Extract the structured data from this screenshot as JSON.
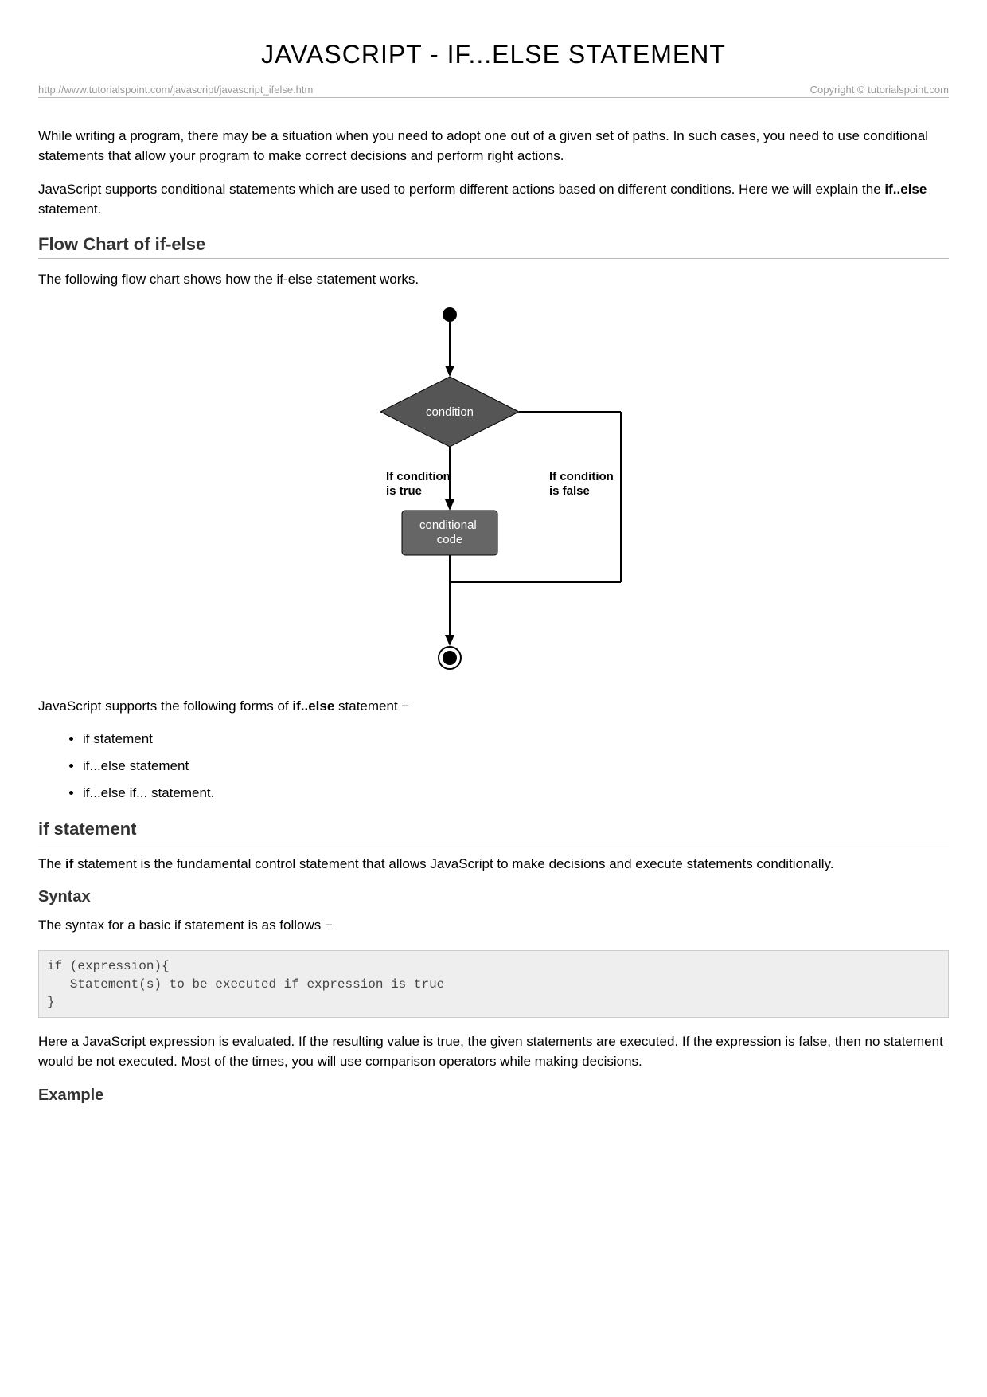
{
  "title": "JAVASCRIPT - IF...ELSE STATEMENT",
  "meta": {
    "url": "http://www.tutorialspoint.com/javascript/javascript_ifelse.htm",
    "copyright": "Copyright © tutorialspoint.com"
  },
  "paragraphs": {
    "intro1": "While writing a program, there may be a situation when you need to adopt one out of a given set of paths. In such cases, you need to use conditional statements that allow your program to make correct decisions and perform right actions.",
    "intro2_pre": "JavaScript supports conditional statements which are used to perform different actions based on different conditions. Here we will explain the ",
    "intro2_bold": "if..else",
    "intro2_post": " statement.",
    "flow_intro": "The following flow chart shows how the if-else statement works.",
    "forms_intro_pre": "JavaScript supports the following forms of ",
    "forms_intro_bold": "if..else",
    "forms_intro_post": " statement −",
    "if_desc_pre": "The ",
    "if_desc_bold": "if",
    "if_desc_post": " statement is the fundamental control statement that allows JavaScript to make decisions and execute statements conditionally.",
    "syntax_intro": "The syntax for a basic if statement is as follows −",
    "syntax_after_pre": "Here a JavaScript expression is evaluated. If the resulting value is true, the given statement",
    "syntax_after_italic": "s",
    "syntax_after_post": " are executed. If the expression is false, then no statement would be not executed. Most of the times, you will use comparison operators while making decisions."
  },
  "headings": {
    "flowchart": "Flow Chart of if-else",
    "if_statement": "if statement",
    "syntax": "Syntax",
    "example": "Example"
  },
  "forms_list": [
    "if statement",
    "if...else statement",
    "if...else if... statement."
  ],
  "code": {
    "syntax": "if (expression){\n   Statement(s) to be executed if expression is true\n}"
  },
  "flowchart_labels": {
    "condition": "condition",
    "true": "If condition\nis true",
    "false": "If condition\nis false",
    "code": "conditional\ncode"
  }
}
